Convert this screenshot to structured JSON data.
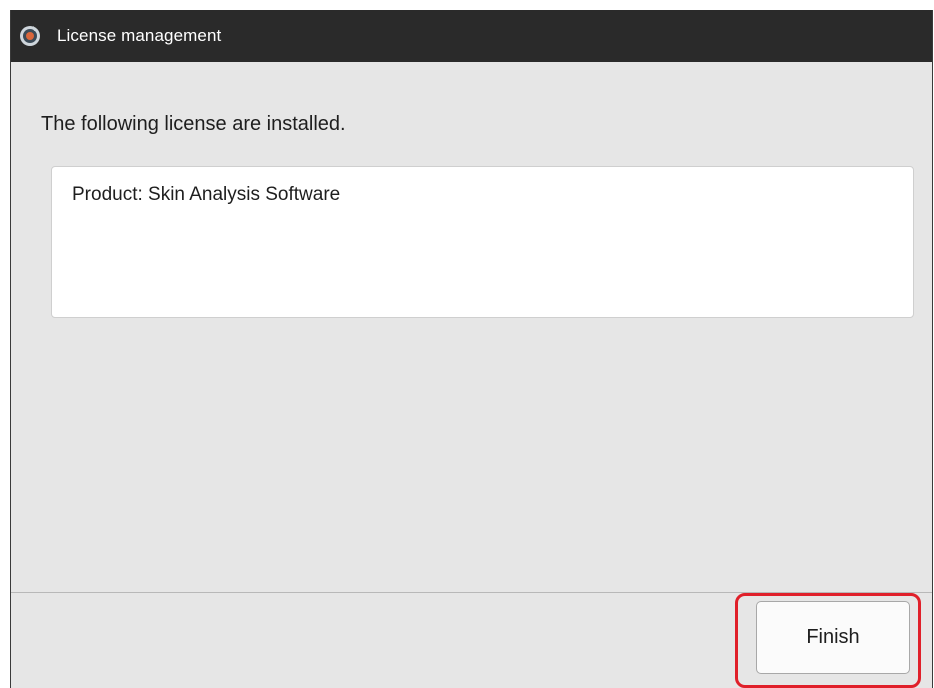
{
  "window": {
    "title": "License management",
    "icon": "app-logo-icon"
  },
  "main": {
    "heading": "The following license are installed.",
    "licenses": [
      "Product: Skin Analysis Software"
    ]
  },
  "footer": {
    "finish_label": "Finish"
  },
  "colors": {
    "titlebar": "#2a2a2a",
    "window_background": "#e6e6e6",
    "highlight": "#e0202a"
  }
}
